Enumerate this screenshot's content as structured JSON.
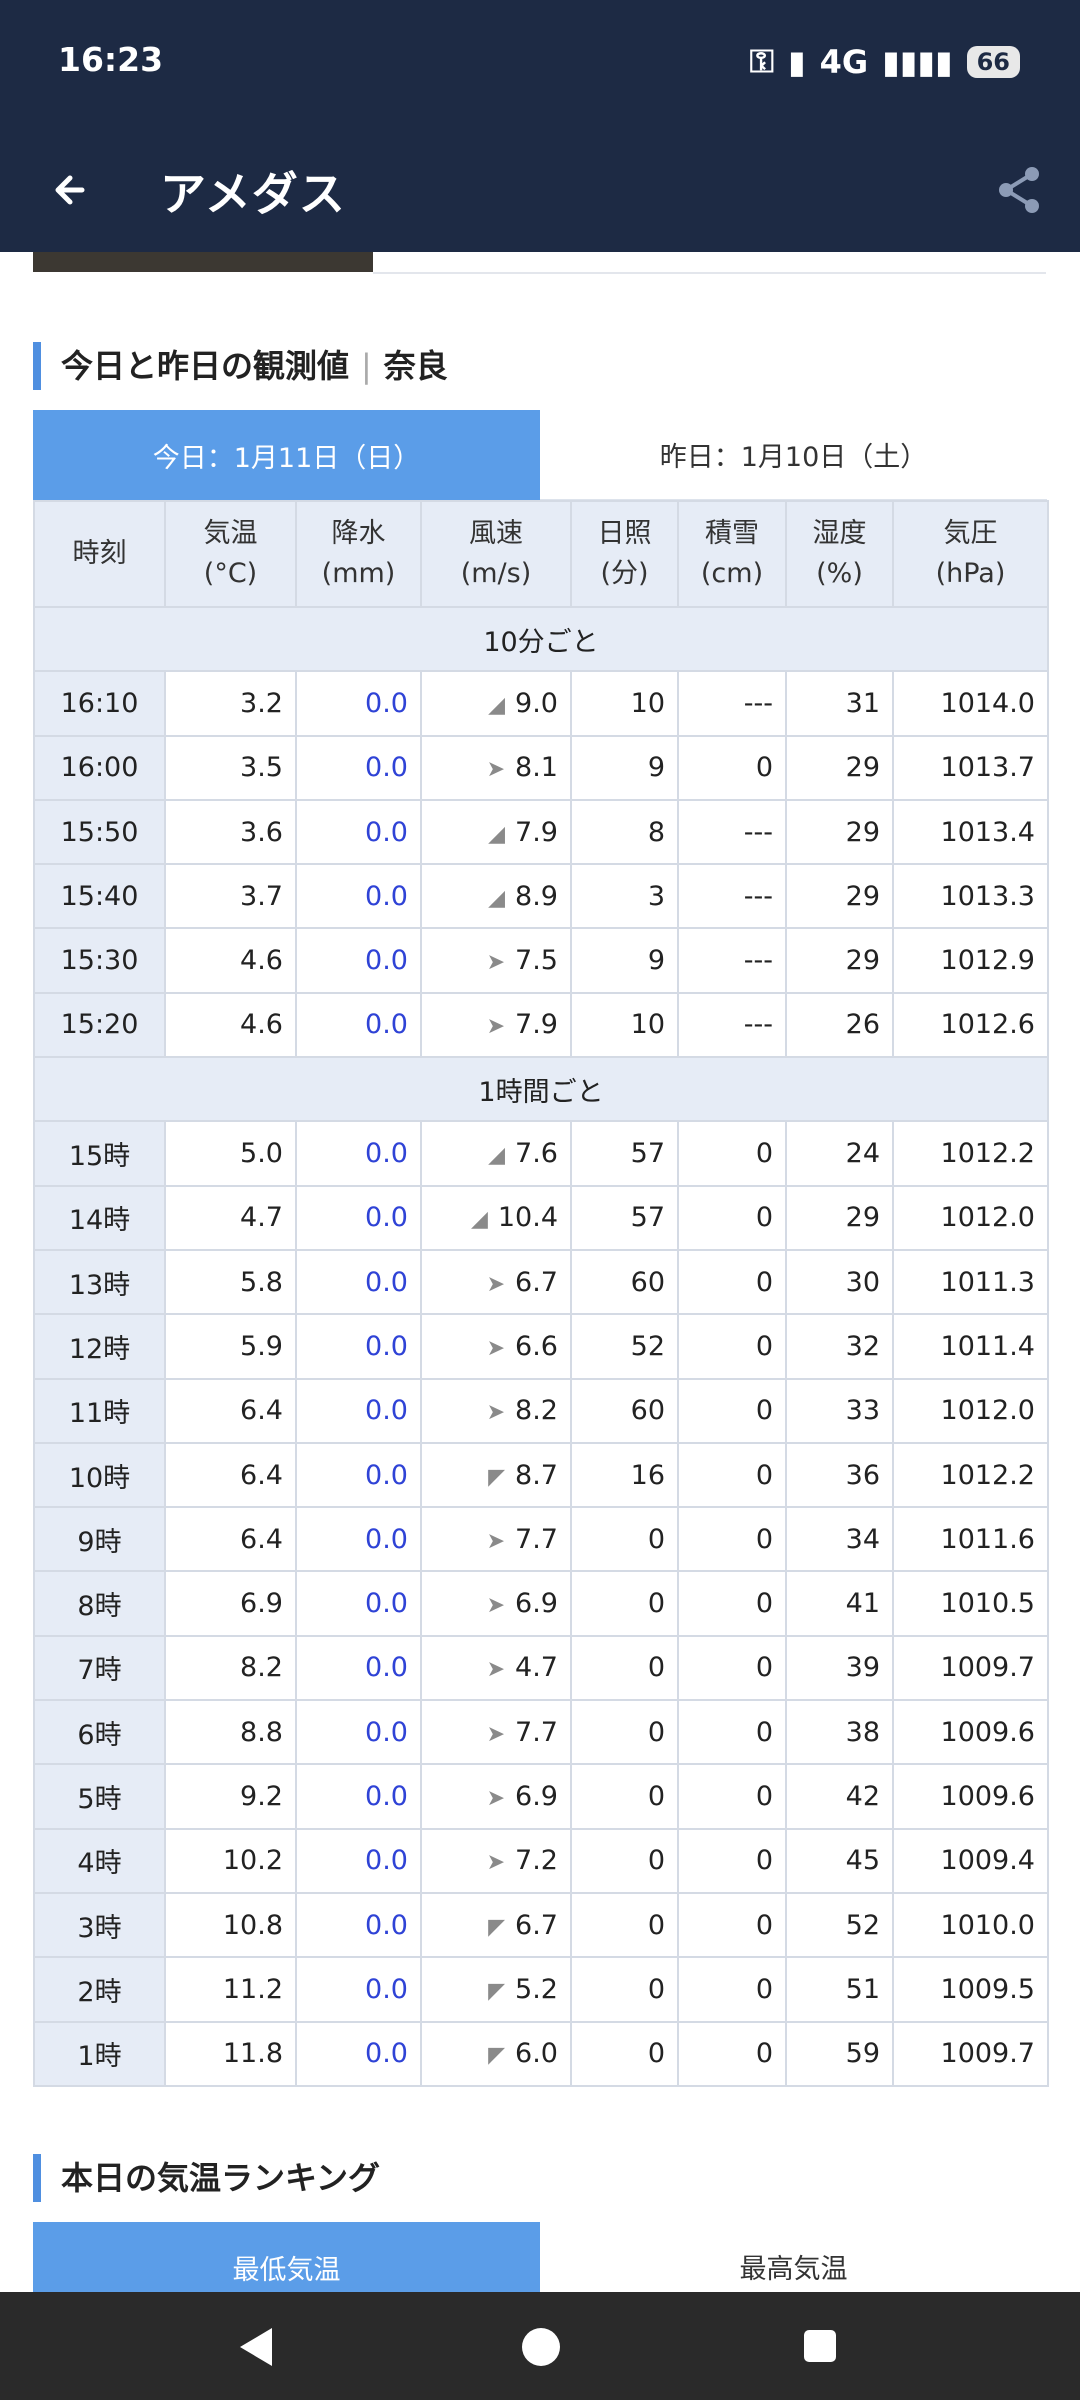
{
  "status": {
    "time": "16:23",
    "network": "4G",
    "battery": "66"
  },
  "appbar": {
    "title": "アメダス"
  },
  "section1": {
    "title": "今日と昨日の観測値",
    "place": "奈良"
  },
  "tabs": {
    "today": "今日：1月11日（日）",
    "yesterday": "昨日：1月10日（土）"
  },
  "table": {
    "headers": [
      {
        "l1": "時刻",
        "l2": ""
      },
      {
        "l1": "気温",
        "l2": "(°C)"
      },
      {
        "l1": "降水",
        "l2": "(mm)"
      },
      {
        "l1": "風速",
        "l2": "(m/s)"
      },
      {
        "l1": "日照",
        "l2": "(分)"
      },
      {
        "l1": "積雪",
        "l2": "(cm)"
      },
      {
        "l1": "湿度",
        "l2": "(%)"
      },
      {
        "l1": "気圧",
        "l2": "(hPa)"
      }
    ],
    "group10": "10分ごと",
    "rows10": [
      [
        "16:10",
        "3.2",
        "0.0",
        "9.0",
        "10",
        "---",
        "31",
        "1014.0"
      ],
      [
        "16:00",
        "3.5",
        "0.0",
        "8.1",
        "9",
        "0",
        "29",
        "1013.7"
      ],
      [
        "15:50",
        "3.6",
        "0.0",
        "7.9",
        "8",
        "---",
        "29",
        "1013.4"
      ],
      [
        "15:40",
        "3.7",
        "0.0",
        "8.9",
        "3",
        "---",
        "29",
        "1013.3"
      ],
      [
        "15:30",
        "4.6",
        "0.0",
        "7.5",
        "9",
        "---",
        "29",
        "1012.9"
      ],
      [
        "15:20",
        "4.6",
        "0.0",
        "7.9",
        "10",
        "---",
        "26",
        "1012.6"
      ]
    ],
    "group1h": "1時間ごと",
    "rows1h": [
      [
        "15時",
        "5.0",
        "0.0",
        "7.6",
        "57",
        "0",
        "24",
        "1012.2"
      ],
      [
        "14時",
        "4.7",
        "0.0",
        "10.4",
        "57",
        "0",
        "29",
        "1012.0"
      ],
      [
        "13時",
        "5.8",
        "0.0",
        "6.7",
        "60",
        "0",
        "30",
        "1011.3"
      ],
      [
        "12時",
        "5.9",
        "0.0",
        "6.6",
        "52",
        "0",
        "32",
        "1011.4"
      ],
      [
        "11時",
        "6.4",
        "0.0",
        "8.2",
        "60",
        "0",
        "33",
        "1012.0"
      ],
      [
        "10時",
        "6.4",
        "0.0",
        "8.7",
        "16",
        "0",
        "36",
        "1012.2"
      ],
      [
        "9時",
        "6.4",
        "0.0",
        "7.7",
        "0",
        "0",
        "34",
        "1011.6"
      ],
      [
        "8時",
        "6.9",
        "0.0",
        "6.9",
        "0",
        "0",
        "41",
        "1010.5"
      ],
      [
        "7時",
        "8.2",
        "0.0",
        "4.7",
        "0",
        "0",
        "39",
        "1009.7"
      ],
      [
        "6時",
        "8.8",
        "0.0",
        "7.7",
        "0",
        "0",
        "38",
        "1009.6"
      ],
      [
        "5時",
        "9.2",
        "0.0",
        "6.9",
        "0",
        "0",
        "42",
        "1009.6"
      ],
      [
        "4時",
        "10.2",
        "0.0",
        "7.2",
        "0",
        "0",
        "45",
        "1009.4"
      ],
      [
        "3時",
        "10.8",
        "0.0",
        "6.7",
        "0",
        "0",
        "52",
        "1010.0"
      ],
      [
        "2時",
        "11.2",
        "0.0",
        "5.2",
        "0",
        "0",
        "51",
        "1009.5"
      ],
      [
        "1時",
        "11.8",
        "0.0",
        "6.0",
        "0",
        "0",
        "59",
        "1009.7"
      ]
    ]
  },
  "section2": {
    "title": "本日の気温ランキング"
  },
  "rankTabs": {
    "low": "最低気温",
    "high": "最高気温"
  }
}
